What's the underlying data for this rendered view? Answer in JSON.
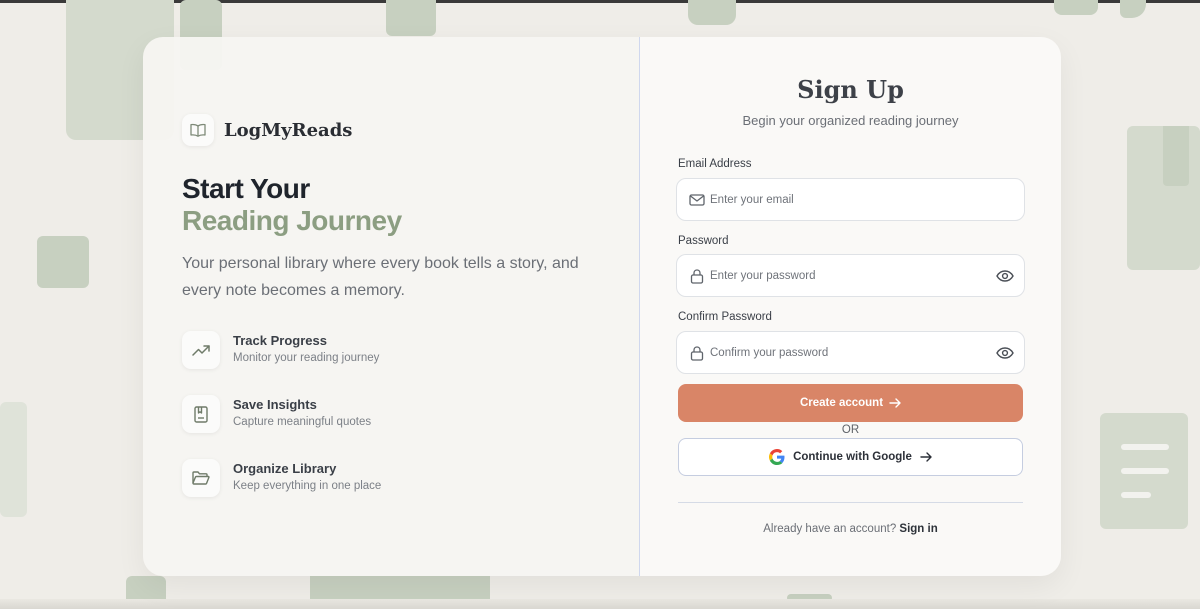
{
  "brand": {
    "name": "LogMyReads",
    "logo_icon": "open-book-icon"
  },
  "hero": {
    "line1": "Start Your",
    "line2": "Reading Journey",
    "description": "Your personal library where every book tells a story, and every note becomes a memory."
  },
  "features": [
    {
      "icon": "trending-up-icon",
      "title": "Track Progress",
      "description": "Monitor your reading journey"
    },
    {
      "icon": "book-bookmark-icon",
      "title": "Save Insights",
      "description": "Capture meaningful quotes"
    },
    {
      "icon": "folder-open-icon",
      "title": "Organize Library",
      "description": "Keep everything in one place"
    }
  ],
  "form": {
    "title": "Sign Up",
    "subtitle": "Begin your organized reading journey",
    "email": {
      "label": "Email Address",
      "placeholder": "Enter your email",
      "value": ""
    },
    "password": {
      "label": "Password",
      "placeholder": "Enter your password",
      "value": ""
    },
    "confirm_password": {
      "label": "Confirm Password",
      "placeholder": "Confirm your password",
      "value": ""
    },
    "create_button": "Create account",
    "divider_text": "OR",
    "google_button": "Continue with Google",
    "signin_prompt": "Already have an account?",
    "signin_link": "Sign in"
  },
  "colors": {
    "accent": "#d98567",
    "sage": "#8c9e82",
    "background": "#efede8",
    "decor": "#c7d0c0"
  }
}
